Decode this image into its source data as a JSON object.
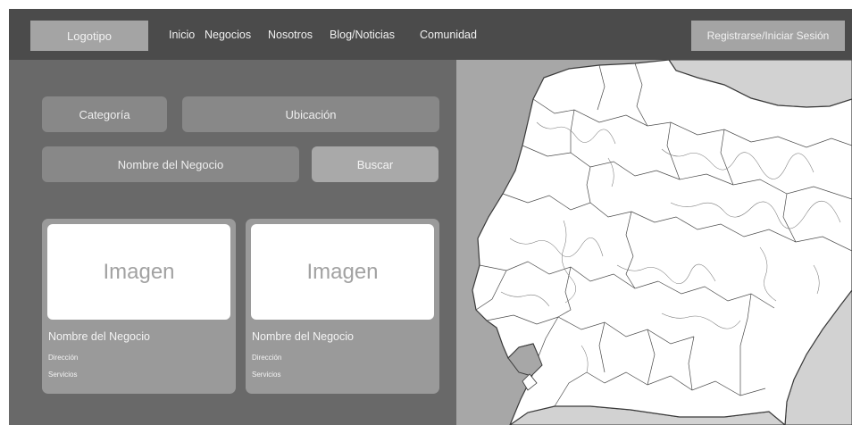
{
  "header": {
    "logo": "Logotipo",
    "nav": [
      "Inicio",
      "Negocios",
      "Nosotros",
      "Blog/Noticias",
      "Comunidad"
    ],
    "register": "Registrarse/Iniciar Sesión"
  },
  "search": {
    "category": "Categoría",
    "location": "Ubicación",
    "business_name": "Nombre del Negocio",
    "search_button": "Buscar"
  },
  "cards": [
    {
      "image_label": "Imagen",
      "title": "Nombre del Negocio",
      "address": "Dirección",
      "services": "Servicios"
    },
    {
      "image_label": "Imagen",
      "title": "Nombre del Negocio",
      "address": "Dirección",
      "services": "Servicios"
    }
  ],
  "colors": {
    "header_bg": "#4b4b4b",
    "panel_bg": "#696969",
    "field_bg": "#888888",
    "button_bg": "#a9a9a9",
    "card_bg": "#9a9a9a"
  },
  "map": {
    "icon": "ecuador-regional-map"
  }
}
